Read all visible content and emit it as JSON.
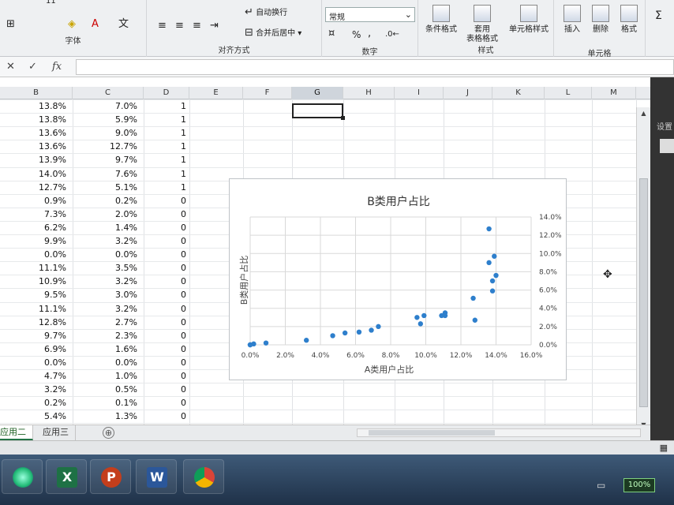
{
  "ribbon": {
    "font_group_label": "字体",
    "align_group_label": "对齐方式",
    "number_group_label": "数字",
    "styles_group_label": "样式",
    "cells_group_label": "单元格",
    "wrap_text": "自动换行",
    "merge_center": "合并后居中",
    "number_format": "常规",
    "percent": "%",
    "comma": ",",
    "conditional_format": "条件格式",
    "table_format_l1": "套用",
    "table_format_l2": "表格格式",
    "cell_styles": "单元格样式",
    "insert": "插入",
    "delete": "删除",
    "format": "格式",
    "autosum": "Σ",
    "font_size": "11"
  },
  "formula_bar": {
    "cancel": "✕",
    "enter": "✓",
    "fx": "fx",
    "value": ""
  },
  "columns": [
    "B",
    "C",
    "D",
    "E",
    "F",
    "G",
    "H",
    "I",
    "J",
    "K",
    "L",
    "M"
  ],
  "selected_column": "G",
  "rows": [
    [
      "13.8%",
      "7.0%",
      "1"
    ],
    [
      "13.8%",
      "5.9%",
      "1"
    ],
    [
      "13.6%",
      "9.0%",
      "1"
    ],
    [
      "13.6%",
      "12.7%",
      "1"
    ],
    [
      "13.9%",
      "9.7%",
      "1"
    ],
    [
      "14.0%",
      "7.6%",
      "1"
    ],
    [
      "12.7%",
      "5.1%",
      "1"
    ],
    [
      "0.9%",
      "0.2%",
      "0"
    ],
    [
      "7.3%",
      "2.0%",
      "0"
    ],
    [
      "6.2%",
      "1.4%",
      "0"
    ],
    [
      "9.9%",
      "3.2%",
      "0"
    ],
    [
      "0.0%",
      "0.0%",
      "0"
    ],
    [
      "11.1%",
      "3.5%",
      "0"
    ],
    [
      "10.9%",
      "3.2%",
      "0"
    ],
    [
      "9.5%",
      "3.0%",
      "0"
    ],
    [
      "11.1%",
      "3.2%",
      "0"
    ],
    [
      "12.8%",
      "2.7%",
      "0"
    ],
    [
      "9.7%",
      "2.3%",
      "0"
    ],
    [
      "6.9%",
      "1.6%",
      "0"
    ],
    [
      "0.0%",
      "0.0%",
      "0"
    ],
    [
      "4.7%",
      "1.0%",
      "0"
    ],
    [
      "3.2%",
      "0.5%",
      "0"
    ],
    [
      "0.2%",
      "0.1%",
      "0"
    ],
    [
      "5.4%",
      "1.3%",
      "0"
    ]
  ],
  "sheet_tabs": [
    "应用二",
    "应用三"
  ],
  "active_tab": 0,
  "add_sheet": "⊕",
  "right_pane_label": "设置",
  "taskbar": {
    "battery": "100%",
    "apps": [
      "start-orb",
      "excel",
      "powerpoint",
      "word",
      "chrome"
    ]
  },
  "chart_data": {
    "type": "scatter",
    "title": "B类用户占比",
    "xlabel": "A类用户占比",
    "ylabel": "B类用户占比",
    "xlim": [
      0,
      0.16
    ],
    "ylim": [
      0,
      0.14
    ],
    "xticks": [
      "0.0%",
      "2.0%",
      "4.0%",
      "6.0%",
      "8.0%",
      "10.0%",
      "12.0%",
      "14.0%",
      "16.0%"
    ],
    "yticks": [
      "0.0%",
      "2.0%",
      "4.0%",
      "6.0%",
      "8.0%",
      "10.0%",
      "12.0%",
      "14.0%"
    ],
    "y_axis_side": "right",
    "grid": true,
    "marker_color": "#2e7fcc",
    "x": [
      0.138,
      0.138,
      0.136,
      0.136,
      0.139,
      0.14,
      0.127,
      0.009,
      0.073,
      0.062,
      0.099,
      0.0,
      0.111,
      0.109,
      0.095,
      0.111,
      0.128,
      0.097,
      0.069,
      0.0,
      0.047,
      0.032,
      0.002,
      0.054
    ],
    "y": [
      0.07,
      0.059,
      0.09,
      0.127,
      0.097,
      0.076,
      0.051,
      0.002,
      0.02,
      0.014,
      0.032,
      0.0,
      0.035,
      0.032,
      0.03,
      0.032,
      0.027,
      0.023,
      0.016,
      0.0,
      0.01,
      0.005,
      0.001,
      0.013
    ]
  }
}
